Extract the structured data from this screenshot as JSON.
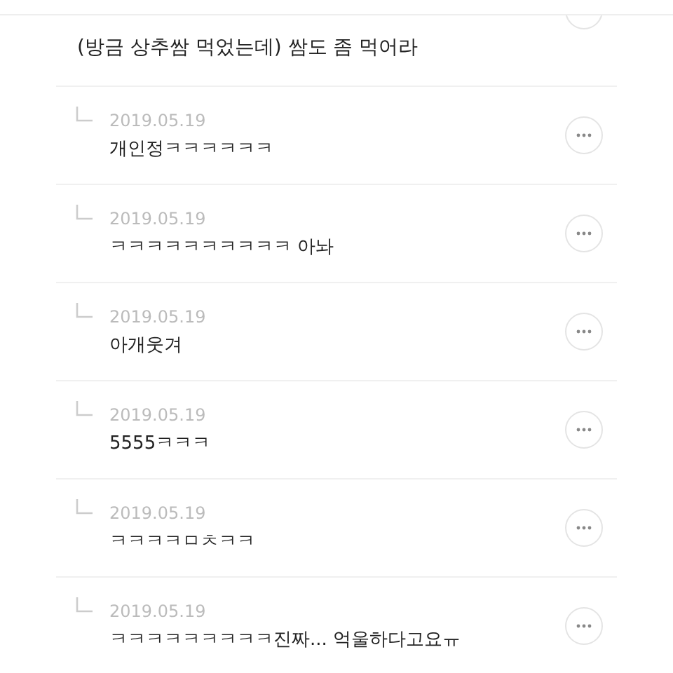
{
  "top_comment": {
    "text": "(방금 상추쌈 먹었는데) 쌈도 좀 먹어라"
  },
  "replies": [
    {
      "date": "2019.05.19",
      "text": "개인정ㅋㅋㅋㅋㅋㅋ"
    },
    {
      "date": "2019.05.19",
      "text": "ㅋㅋㅋㅋㅋㅋㅋㅋㅋㅋ 아놔"
    },
    {
      "date": "2019.05.19",
      "text": "아개웃겨"
    },
    {
      "date": "2019.05.19",
      "text": "5555ㅋㅋㅋ"
    },
    {
      "date": "2019.05.19",
      "text": "ㅋㅋㅋㅋㅁㅊㅋㅋ"
    },
    {
      "date": "2019.05.19",
      "text": "ㅋㅋㅋㅋㅋㅋㅋㅋㅋ진짜... 억울하다고요ㅠ"
    }
  ]
}
